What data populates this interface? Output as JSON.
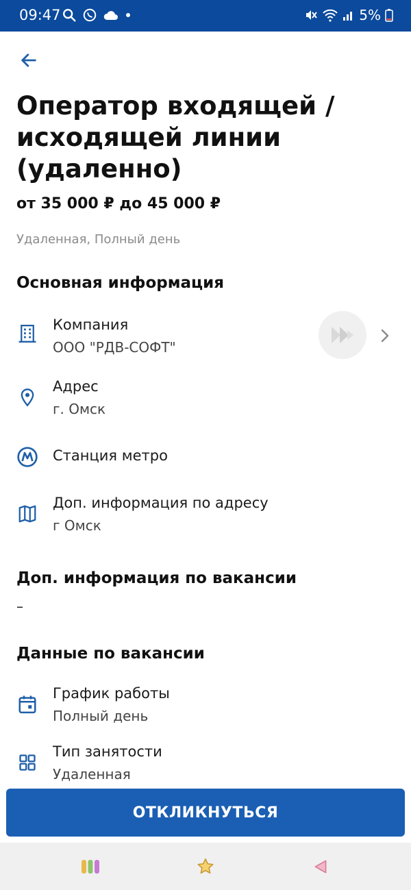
{
  "status_bar": {
    "time": "09:47",
    "battery": "5%"
  },
  "vacancy": {
    "title": "Оператор входящей / исходящей линии (удаленно)",
    "salary": "от 35 000 ₽ до 45 000 ₽",
    "tags": "Удаленная, Полный день"
  },
  "main_info": {
    "section_title": "Основная информация",
    "company_label": "Компания",
    "company_value": "ООО \"РДВ-СОФТ\"",
    "address_label": "Адрес",
    "address_value": "г. Омск",
    "metro_label": "Станция метро",
    "extra_address_label": "Доп. информация по адресу",
    "extra_address_value": "г Омск"
  },
  "extra_info": {
    "section_title": "Доп. информация по вакансии",
    "value": "–"
  },
  "vacancy_data": {
    "section_title": "Данные по вакансии",
    "schedule_label": "График работы",
    "schedule_value": "Полный день",
    "employment_label": "Тип занятости",
    "employment_value": "Удаленная"
  },
  "apply_button": "ОТКЛИКНУТЬСЯ",
  "colors": {
    "accent": "#1a5fb4",
    "status_bar": "#0b4a9c",
    "icon": "#1f5fa8"
  },
  "icons": {
    "back": "arrow-left-icon",
    "company": "building-icon",
    "address": "location-pin-icon",
    "metro": "metro-icon",
    "extra_address": "map-icon",
    "schedule": "calendar-icon",
    "employment": "grid-icon"
  }
}
